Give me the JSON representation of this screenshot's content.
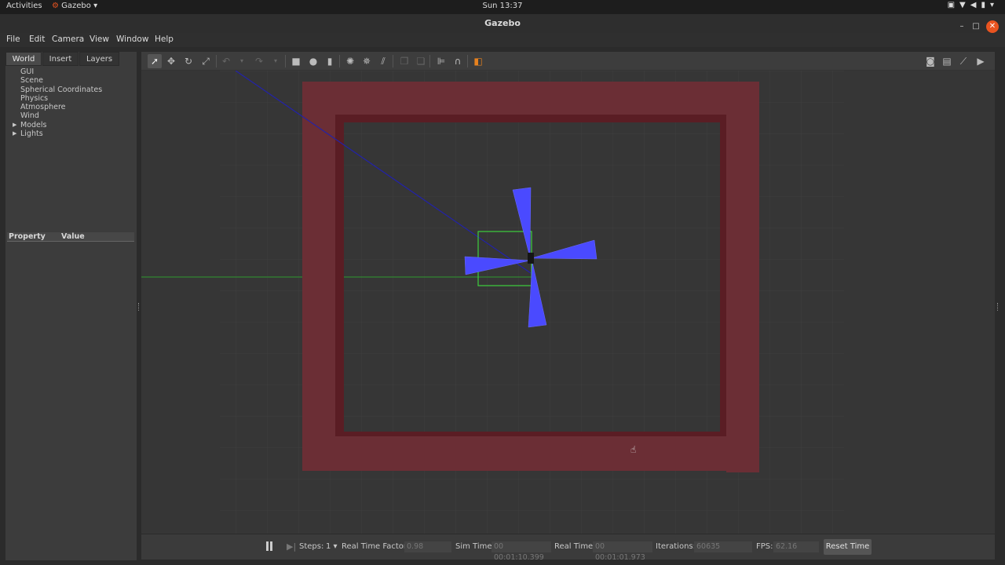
{
  "topbar": {
    "activities": "Activities",
    "app_name": "Gazebo",
    "clock": "Sun 13:37",
    "tray_icons": [
      "camera-icon",
      "wifi-icon",
      "volume-icon",
      "battery-icon",
      "chevron-down-icon"
    ]
  },
  "window": {
    "title": "Gazebo",
    "controls": [
      "minimize-icon",
      "maximize-icon",
      "close-icon"
    ]
  },
  "menubar": [
    "File",
    "Edit",
    "Camera",
    "View",
    "Window",
    "Help"
  ],
  "left_panel": {
    "tabs": [
      "World",
      "Insert",
      "Layers"
    ],
    "active_tab": "World",
    "tree": [
      {
        "label": "GUI",
        "expandable": false
      },
      {
        "label": "Scene",
        "expandable": false
      },
      {
        "label": "Spherical Coordinates",
        "expandable": false
      },
      {
        "label": "Physics",
        "expandable": false
      },
      {
        "label": "Atmosphere",
        "expandable": false
      },
      {
        "label": "Wind",
        "expandable": false
      },
      {
        "label": "Models",
        "expandable": true
      },
      {
        "label": "Lights",
        "expandable": true
      }
    ],
    "property_header": {
      "property": "Property",
      "value": "Value"
    }
  },
  "toolbar": {
    "tools": [
      "select-arrow-icon",
      "translate-icon",
      "rotate-icon",
      "scale-icon",
      "undo-icon",
      "redo-icon",
      "box-icon",
      "sphere-icon",
      "cylinder-icon",
      "point-light-icon",
      "spot-light-icon",
      "directional-light-icon",
      "copy-icon",
      "paste-icon",
      "align-icon",
      "magnet-icon",
      "view-angle-icon"
    ],
    "right_tools": [
      "screenshot-icon",
      "log-icon",
      "plot-icon",
      "record-icon"
    ]
  },
  "statusbar": {
    "steps_label": "Steps:",
    "steps_value": "1",
    "rtf_label": "Real Time Factor:",
    "rtf_value": "0.98",
    "sim_time_label": "Sim Time:",
    "sim_time_value": "00 00:01:10.399",
    "real_time_label": "Real Time:",
    "real_time_value": "00 00:01:01.973",
    "iterations_label": "Iterations:",
    "iterations_value": "60635",
    "fps_label": "FPS:",
    "fps_value": "62.16",
    "reset_label": "Reset Time"
  },
  "colors": {
    "wall": "#6b2e35",
    "wall_inner": "#5a1d24",
    "laser": "#4a4aff",
    "bbox": "#3ccf3c",
    "ground": "#363636",
    "accent": "#e95420"
  }
}
